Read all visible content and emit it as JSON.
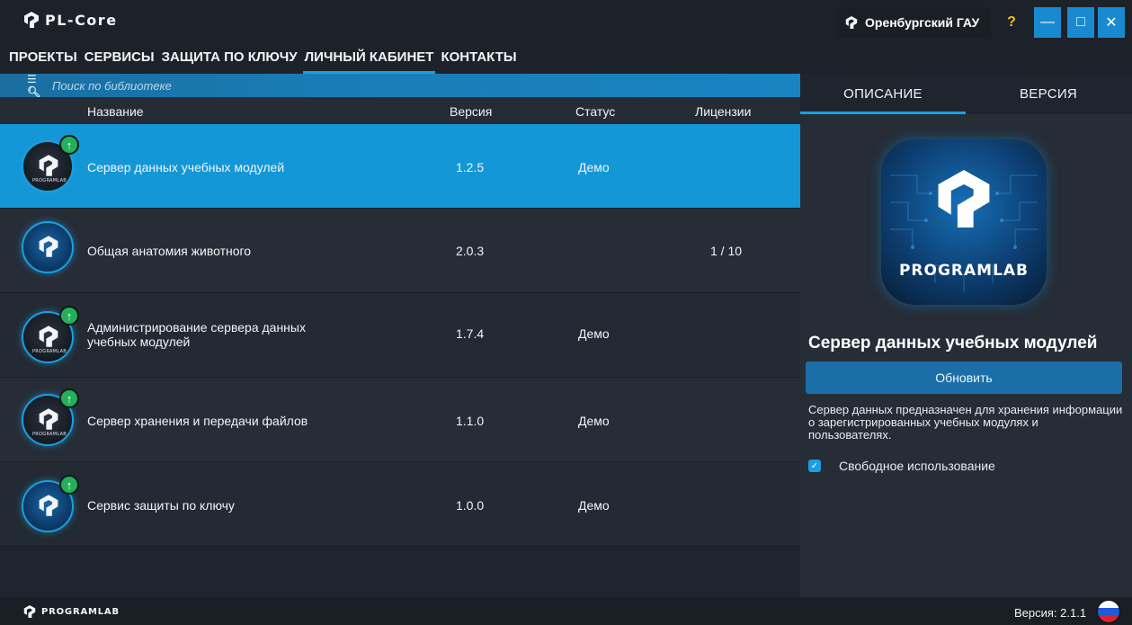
{
  "app": {
    "title": "PL-Core"
  },
  "header": {
    "organization": "Оренбургский ГАУ",
    "help_label": "?",
    "minimize_label": "—",
    "maximize_label": "□",
    "close_label": "✕"
  },
  "nav": {
    "items": [
      {
        "label": "ПРОЕКТЫ"
      },
      {
        "label": "СЕРВИСЫ"
      },
      {
        "label": "ЗАЩИТА ПО КЛЮЧУ"
      },
      {
        "label": "ЛИЧНЫЙ КАБИНЕТ"
      },
      {
        "label": "КОНТАКТЫ"
      }
    ],
    "active_index": 3
  },
  "search": {
    "placeholder": "Поиск по библиотеке"
  },
  "table": {
    "headers": {
      "name": "Название",
      "version": "Версия",
      "status": "Статус",
      "licenses": "Лицензии"
    },
    "rows": [
      {
        "name": "Сервер данных учебных модулей",
        "version": "1.2.5",
        "status": "Демо",
        "licenses": "",
        "update_available": true,
        "icon_sub": "PROGRAMLAB"
      },
      {
        "name": "Общая анатомия животного",
        "version": "2.0.3",
        "status": "",
        "licenses": "1 / 10",
        "update_available": false,
        "icon_sub": ""
      },
      {
        "name": "Администрирование сервера данных учебных модулей",
        "version": "1.7.4",
        "status": "Демо",
        "licenses": "",
        "update_available": true,
        "icon_sub": "PROGRAMLAB"
      },
      {
        "name": "Сервер хранения и передачи файлов",
        "version": "1.1.0",
        "status": "Демо",
        "licenses": "",
        "update_available": true,
        "icon_sub": "PROGRAMLAB"
      },
      {
        "name": "Сервис защиты по ключу",
        "version": "1.0.0",
        "status": "Демо",
        "licenses": "",
        "update_available": true,
        "icon_sub": ""
      }
    ]
  },
  "panel": {
    "tabs": [
      {
        "label": "ОПИСАНИЕ"
      },
      {
        "label": "ВЕРСИЯ"
      }
    ],
    "brand": "PROGRAMLAB",
    "product_title": "Сервер данных учебных модулей",
    "update_button": "Обновить",
    "description": "Сервер данных предназначен для хранения информации о зарегистрированных учебных модулях и пользователях.",
    "free_use_label": "Свободное использование",
    "free_use_checked": true
  },
  "footer": {
    "brand": "PROGRAMLAB",
    "version": "Версия: 2.1.1"
  },
  "colors": {
    "accent": "#1497d6",
    "update_badge": "#23b05a",
    "warning_help": "#f0c020"
  }
}
